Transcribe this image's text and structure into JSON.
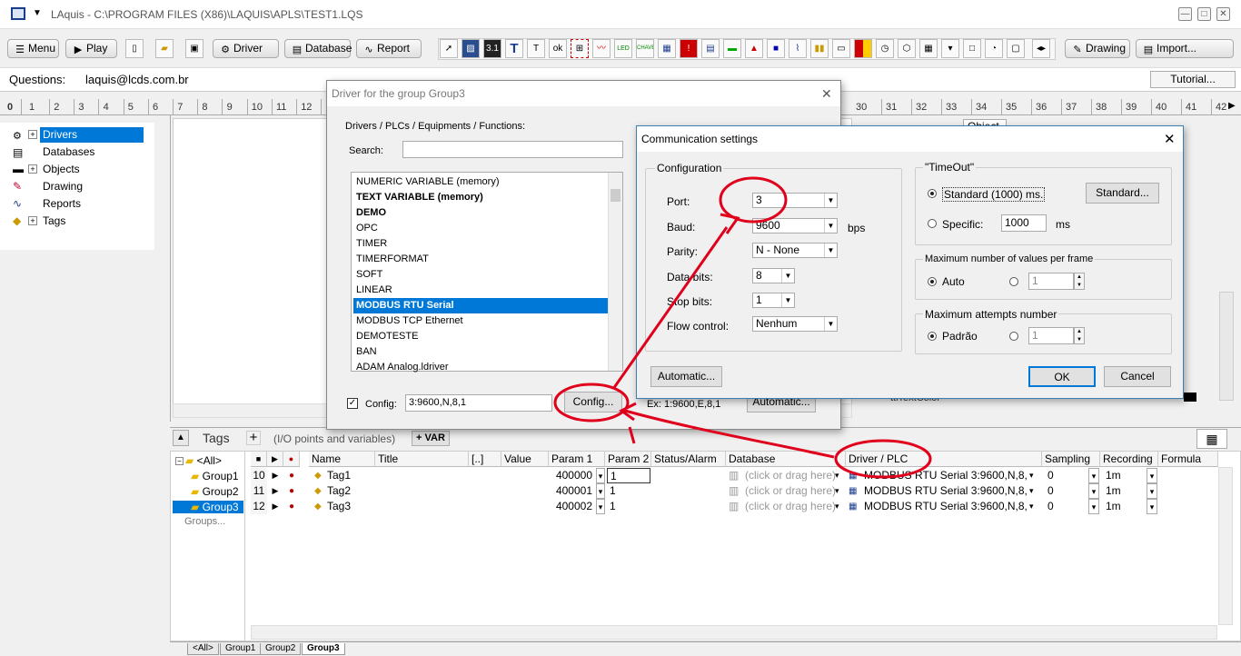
{
  "window": {
    "title": "LAquis - C:\\PROGRAM FILES (X86)\\LAQUIS\\APLS\\TEST1.LQS"
  },
  "toolbar": {
    "menu_label": "Menu",
    "play_label": "Play",
    "driver_label": "Driver",
    "database_label": "Database",
    "report_label": "Report",
    "drawing_label": "Drawing",
    "import_label": "Import...",
    "icon_labels": [
      "T",
      "T",
      "LED",
      "CHAVE"
    ]
  },
  "questions": {
    "label": "Questions:",
    "email": "laquis@lcds.com.br",
    "tutorial_label": "Tutorial..."
  },
  "ruler": {
    "left": [
      "0",
      "1",
      "2",
      "3",
      "4",
      "5",
      "6",
      "7",
      "8",
      "9",
      "10",
      "11",
      "12"
    ],
    "right": [
      "30",
      "31",
      "32",
      "33",
      "34",
      "35",
      "36",
      "37",
      "38",
      "39",
      "40",
      "41",
      "42"
    ]
  },
  "tree": {
    "items": [
      "Drivers",
      "Databases",
      "Objects",
      "Drawing",
      "Reports",
      "Tags"
    ]
  },
  "tags": {
    "title": "Tags",
    "hint": "(I/O points and variables)",
    "var_button": "+ VAR",
    "groups": [
      "<All>",
      "Group1",
      "Group2",
      "Group3"
    ],
    "groups_more": "Groups...",
    "columns": [
      "■",
      "▶",
      "●",
      "Name",
      "Title",
      "[..]",
      "Value",
      "Param 1",
      "Param 2",
      "Status/Alarm",
      "Database",
      "Driver / PLC",
      "Sampling",
      "Recording",
      "Formula"
    ],
    "rows": [
      {
        "num": "10",
        "name": "Tag1",
        "param1": "400000",
        "param2": "1",
        "database": "(click or drag here)",
        "driver": "MODBUS RTU Serial 3:9600,N,8,1",
        "sampling": "0",
        "recording": "1m"
      },
      {
        "num": "11",
        "name": "Tag2",
        "param1": "400001",
        "param2": "1",
        "database": "(click or drag here)",
        "driver": "MODBUS RTU Serial 3:9600,N,8,1",
        "sampling": "0",
        "recording": "1m"
      },
      {
        "num": "12",
        "name": "Tag3",
        "param1": "400002",
        "param2": "1",
        "database": "(click or drag here)",
        "driver": "MODBUS RTU Serial 3:9600,N,8,1",
        "sampling": "0",
        "recording": "1m"
      }
    ],
    "bottom_tabs": [
      "<All>",
      "Group1",
      "Group2",
      "Group3"
    ]
  },
  "driver_dialog": {
    "title": "Driver for the group Group3",
    "list_label": "Drivers / PLCs / Equipments / Functions:",
    "search_label": "Search:",
    "search_value": "",
    "items": [
      "NUMERIC VARIABLE (memory)",
      "TEXT VARIABLE (memory)",
      "DEMO",
      "OPC",
      "TIMER",
      "TIMERFORMAT",
      "SOFT",
      "LINEAR",
      "MODBUS RTU Serial",
      "MODBUS TCP Ethernet",
      "DEMOTESTE",
      "BAN",
      "ADAM Analog.ldriver"
    ],
    "selected_index": 8,
    "config_label": "Config:",
    "config_value": "3:9600,N,8,1",
    "config_button": "Config...",
    "example_text": "Ex: 1:9600,E,8,1",
    "automatic_button": "Automatic..."
  },
  "comm_dialog": {
    "title": "Communication settings",
    "configuration_label": "Configuration",
    "port_label": "Port:",
    "port_value": "3",
    "baud_label": "Baud:",
    "baud_value": "9600",
    "baud_unit": "bps",
    "parity_label": "Parity:",
    "parity_value": "N - None",
    "databits_label": "Data bits:",
    "databits_value": "8",
    "stopbits_label": "Stop bits:",
    "stopbits_value": "1",
    "flow_label": "Flow control:",
    "flow_value": "Nenhum",
    "timeout_label": "\"TimeOut\"",
    "timeout_standard": "Standard (1000) ms.",
    "standard_button": "Standard...",
    "timeout_specific": "Specific:",
    "timeout_specific_value": "1000",
    "timeout_unit": "ms",
    "maxvalues_label": "Maximum number of values per frame",
    "maxvalues_auto": "Auto",
    "maxvalues_value": "1",
    "maxattempts_label": "Maximum attempts number",
    "maxattempts_default": "Padrão",
    "maxattempts_value": "1",
    "automatic_button": "Automatic...",
    "ok_button": "OK",
    "cancel_button": "Cancel"
  },
  "background_panel": {
    "tab_object": "Object",
    "color_row_label": "ttlTextColor"
  },
  "colors": {
    "selection": "#0078d7",
    "annotation": "#e0001b",
    "tree_selected": "#0078d7"
  }
}
